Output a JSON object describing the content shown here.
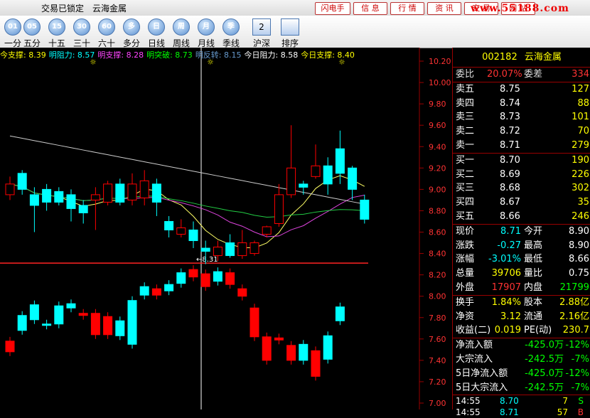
{
  "title_bar": {
    "lock_status": "交易已锁定",
    "stock_name": "云海金属",
    "buttons": [
      "闪电手",
      "信 息",
      "行 情",
      "资 讯",
      "交 易",
      "网 站"
    ],
    "watermark": "www.55188.com"
  },
  "toolbar": {
    "periods": [
      {
        "icon": "01",
        "label": "一分"
      },
      {
        "icon": "05",
        "label": "五分"
      },
      {
        "icon": "15",
        "label": "十五"
      },
      {
        "icon": "30",
        "label": "三十"
      },
      {
        "icon": "60",
        "label": "六十"
      },
      {
        "icon": "多",
        "label": "多分"
      },
      {
        "icon": "日",
        "label": "日线"
      },
      {
        "icon": "周",
        "label": "周线"
      },
      {
        "icon": "月",
        "label": "月线"
      },
      {
        "icon": "季",
        "label": "季线"
      }
    ],
    "extras": [
      {
        "icon": "2",
        "label": "沪深"
      },
      {
        "icon": "",
        "label": "排序"
      }
    ]
  },
  "indicators": [
    {
      "label": "今支撑:",
      "value": "8.39",
      "color": "#ffff00"
    },
    {
      "label": "明阻力:",
      "value": "8.57",
      "color": "#00ffff"
    },
    {
      "label": "明支撑:",
      "value": "8.28",
      "color": "#ff44ff"
    },
    {
      "label": "明突破:",
      "value": "8.73",
      "color": "#00ff00"
    },
    {
      "label": "明反转:",
      "value": "8.15",
      "color": "#6699cc"
    },
    {
      "label": "今日阻力:",
      "value": "8.58",
      "color": "#ffffff"
    },
    {
      "label": "今日支撑:",
      "value": "8.40",
      "color": "#ffff00"
    }
  ],
  "price_axis": [
    "10.20",
    "10.00",
    "9.80",
    "9.60",
    "9.40",
    "9.20",
    "9.00",
    "8.80",
    "8.60",
    "8.40",
    "8.20",
    "8.00",
    "7.80",
    "7.60",
    "7.40",
    "7.20",
    "7.00"
  ],
  "chart_data": {
    "type": "candlestick",
    "ylim": [
      7.0,
      10.2
    ],
    "support_line": 8.31,
    "support_label": "←8.31",
    "candles": [
      {
        "o": 8.95,
        "c": 9.05,
        "h": 9.12,
        "l": 8.9
      },
      {
        "o": 9.15,
        "c": 9.0,
        "h": 9.18,
        "l": 8.95
      },
      {
        "o": 8.95,
        "c": 8.85,
        "h": 9.02,
        "l": 8.6
      },
      {
        "o": 9.0,
        "c": 8.88,
        "h": 9.05,
        "l": 8.8
      },
      {
        "o": 8.98,
        "c": 8.88,
        "h": 9.02,
        "l": 8.85
      },
      {
        "o": 8.95,
        "c": 8.82,
        "h": 9.0,
        "l": 8.7
      },
      {
        "o": 8.85,
        "c": 8.78,
        "h": 8.9,
        "l": 8.68
      },
      {
        "o": 8.9,
        "c": 8.95,
        "h": 9.02,
        "l": 8.62
      },
      {
        "o": 8.88,
        "c": 9.05,
        "h": 9.08,
        "l": 8.85
      },
      {
        "o": 9.05,
        "c": 8.88,
        "h": 9.1,
        "l": 8.85
      },
      {
        "o": 8.9,
        "c": 9.05,
        "h": 9.15,
        "l": 8.85
      },
      {
        "o": 8.92,
        "c": 9.08,
        "h": 9.18,
        "l": 8.85
      },
      {
        "o": 9.05,
        "c": 8.88,
        "h": 9.1,
        "l": 8.75
      },
      {
        "o": 8.7,
        "c": 8.62,
        "h": 8.75,
        "l": 8.55
      },
      {
        "o": 8.58,
        "c": 8.64,
        "h": 8.72,
        "l": 8.55
      },
      {
        "o": 8.62,
        "c": 8.52,
        "h": 8.7,
        "l": 8.45
      },
      {
        "o": 8.45,
        "c": 8.42,
        "h": 8.52,
        "l": 8.3
      },
      {
        "o": 8.38,
        "c": 8.46,
        "h": 8.52,
        "l": 8.33
      },
      {
        "o": 8.5,
        "c": 8.38,
        "h": 8.58,
        "l": 8.36
      },
      {
        "o": 8.38,
        "c": 8.5,
        "h": 8.62,
        "l": 8.35
      },
      {
        "o": 8.4,
        "c": 8.5,
        "h": 8.52,
        "l": 8.38
      },
      {
        "o": 8.58,
        "c": 8.65,
        "h": 8.66,
        "l": 8.55
      },
      {
        "o": 8.68,
        "c": 8.95,
        "h": 9.05,
        "l": 8.65
      },
      {
        "o": 8.95,
        "c": 9.2,
        "h": 9.6,
        "l": 8.92
      },
      {
        "o": 9.05,
        "c": 9.02,
        "h": 9.08,
        "l": 8.95
      },
      {
        "o": 9.12,
        "c": 9.22,
        "h": 9.42,
        "l": 9.1
      },
      {
        "o": 9.22,
        "c": 9.05,
        "h": 9.3,
        "l": 8.95
      },
      {
        "o": 9.38,
        "c": 9.15,
        "h": 9.55,
        "l": 9.05
      },
      {
        "o": 9.2,
        "c": 9.0,
        "h": 9.22,
        "l": 8.9
      },
      {
        "o": 8.9,
        "c": 8.72,
        "h": 8.95,
        "l": 8.68
      }
    ],
    "volume": [
      {
        "o": 7.58,
        "c": 7.48,
        "up": false
      },
      {
        "o": 7.68,
        "c": 7.82,
        "up": true
      },
      {
        "o": 7.78,
        "c": 7.92,
        "up": true
      },
      {
        "o": 7.73,
        "c": 7.74,
        "up": true
      },
      {
        "o": 7.74,
        "c": 7.91,
        "up": true
      },
      {
        "o": 7.89,
        "c": 7.93,
        "up": true
      },
      {
        "o": 7.84,
        "c": 7.82,
        "up": false
      },
      {
        "o": 7.84,
        "c": 7.64,
        "up": false
      },
      {
        "o": 7.81,
        "c": 7.64,
        "up": false
      },
      {
        "o": 7.63,
        "c": 7.77,
        "up": true
      },
      {
        "o": 7.55,
        "c": 7.96,
        "up": true
      },
      {
        "o": 8.01,
        "c": 8.09,
        "up": true
      },
      {
        "o": 8.07,
        "c": 8.01,
        "up": false
      },
      {
        "o": 8.05,
        "c": 8.11,
        "up": true
      },
      {
        "o": 8.12,
        "c": 8.22,
        "up": true
      },
      {
        "o": 8.25,
        "c": 8.18,
        "up": false
      },
      {
        "o": 8.21,
        "c": 8.09,
        "up": false
      },
      {
        "o": 8.14,
        "c": 8.23,
        "up": true
      },
      {
        "o": 8.22,
        "c": 8.11,
        "up": false
      },
      {
        "o": 8.07,
        "c": 8.0,
        "up": false
      },
      {
        "o": 7.89,
        "c": 7.62,
        "up": false
      },
      {
        "o": 7.62,
        "c": 7.4,
        "up": false
      },
      {
        "o": 7.61,
        "c": 7.59,
        "up": false
      },
      {
        "o": 7.54,
        "c": 7.4,
        "up": false
      },
      {
        "o": 7.4,
        "c": 7.55,
        "up": true
      },
      {
        "o": 7.49,
        "c": 7.25,
        "up": false
      },
      {
        "o": 7.41,
        "c": 7.63,
        "up": true
      },
      {
        "o": 7.77,
        "c": 7.9,
        "up": true
      }
    ]
  },
  "quote": {
    "code": "002182",
    "name": "云海金属",
    "weibi_label": "委比",
    "weibi": "20.07%",
    "weicha_label": "委差",
    "weicha": "334",
    "sells": [
      {
        "label": "卖五",
        "price": "8.75",
        "vol": "127"
      },
      {
        "label": "卖四",
        "price": "8.74",
        "vol": "88"
      },
      {
        "label": "卖三",
        "price": "8.73",
        "vol": "101"
      },
      {
        "label": "卖二",
        "price": "8.72",
        "vol": "70"
      },
      {
        "label": "卖一",
        "price": "8.71",
        "vol": "279"
      }
    ],
    "buys": [
      {
        "label": "买一",
        "price": "8.70",
        "vol": "190"
      },
      {
        "label": "买二",
        "price": "8.69",
        "vol": "226"
      },
      {
        "label": "买三",
        "price": "8.68",
        "vol": "302"
      },
      {
        "label": "买四",
        "price": "8.67",
        "vol": "35"
      },
      {
        "label": "买五",
        "price": "8.66",
        "vol": "246"
      }
    ],
    "stats": [
      {
        "l1": "现价",
        "v1": "8.71",
        "c1": "#00ffff",
        "l2": "今开",
        "v2": "8.90",
        "c2": "#ffffff"
      },
      {
        "l1": "涨跌",
        "v1": "-0.27",
        "c1": "#00ffff",
        "l2": "最高",
        "v2": "8.90",
        "c2": "#ffffff"
      },
      {
        "l1": "涨幅",
        "v1": "-3.01%",
        "c1": "#00ffff",
        "l2": "最低",
        "v2": "8.66",
        "c2": "#ffffff"
      },
      {
        "l1": "总量",
        "v1": "39706",
        "c1": "#ffff00",
        "l2": "量比",
        "v2": "0.75",
        "c2": "#ffffff"
      },
      {
        "l1": "外盘",
        "v1": "17907",
        "c1": "#ff3333",
        "l2": "内盘",
        "v2": "21799",
        "c2": "#00ff00"
      }
    ],
    "stats2": [
      {
        "l1": "换手",
        "v1": "1.84%",
        "c1": "#ffff00",
        "l2": "股本",
        "v2": "2.88亿",
        "c2": "#ffff00"
      },
      {
        "l1": "净资",
        "v1": "3.12",
        "c1": "#ffff00",
        "l2": "流通",
        "v2": "2.16亿",
        "c2": "#ffff00"
      },
      {
        "l1": "收益(二)",
        "v1": "0.019",
        "c1": "#ffff00",
        "l2": "PE(动)",
        "v2": "230.7",
        "c2": "#ffff00"
      }
    ],
    "flows": [
      {
        "label": "净流入额",
        "val": "-425.0万",
        "pct": "-12%"
      },
      {
        "label": "大宗流入",
        "val": "-242.5万",
        "pct": "-7%"
      },
      {
        "label": "5日净流入额",
        "val": "-425.0万",
        "pct": "-12%"
      },
      {
        "label": "5日大宗流入",
        "val": "-242.5万",
        "pct": "-7%"
      }
    ],
    "trades": [
      {
        "time": "14:55",
        "price": "8.70",
        "vol": "7",
        "side": "S",
        "sidecolor": "#00ff00"
      },
      {
        "time": "14:55",
        "price": "8.71",
        "vol": "57",
        "side": "B",
        "sidecolor": "#ff3333"
      }
    ]
  },
  "colors": {
    "up": "#ff0000",
    "down": "#00ffff",
    "up_fill": "#000000",
    "ma_white": "#cccccc",
    "ma_yellow": "#ffff66",
    "ma_green": "#22cc44",
    "ma_magenta": "#dd44dd",
    "ma_blue": "#5588ff"
  }
}
